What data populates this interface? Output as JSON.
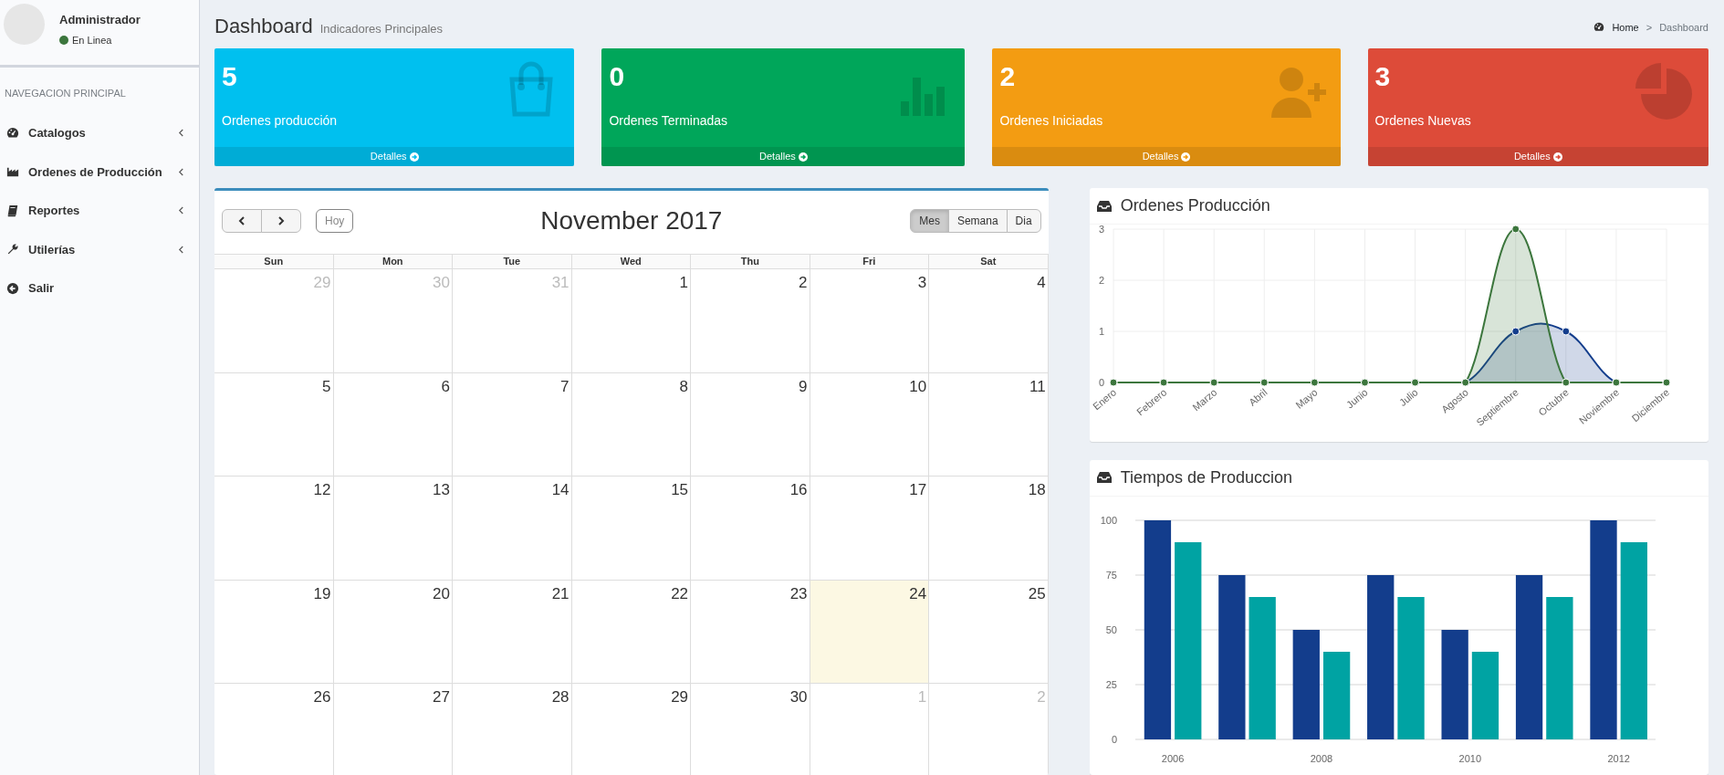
{
  "sidebar": {
    "user": {
      "name": "Administrador",
      "status": "En Linea"
    },
    "header": "NAVEGACION PRINCIPAL",
    "items": [
      {
        "label": "Catalogos",
        "expandable": true
      },
      {
        "label": "Ordenes de Producción",
        "expandable": true
      },
      {
        "label": "Reportes",
        "expandable": true
      },
      {
        "label": "Utilerías",
        "expandable": true
      },
      {
        "label": "Salir",
        "expandable": false
      }
    ]
  },
  "page_header": {
    "title": "Dashboard",
    "subtitle": "Indicadores Principales",
    "breadcrumb": {
      "items": [
        "Home",
        "Dashboard"
      ],
      "separator": ">"
    }
  },
  "info_boxes": [
    {
      "number": "5",
      "label": "Ordenes producción",
      "footer": "Detalles",
      "color": "#00c0ef"
    },
    {
      "number": "0",
      "label": "Ordenes Terminadas",
      "footer": "Detalles",
      "color": "#00a65a"
    },
    {
      "number": "2",
      "label": "Ordenes Iniciadas",
      "footer": "Detalles",
      "color": "#f39c12"
    },
    {
      "number": "3",
      "label": "Ordenes Nuevas",
      "footer": "Detalles",
      "color": "#dd4b39"
    }
  ],
  "calendar": {
    "title": "November 2017",
    "today_button": {
      "label": "Hoy",
      "disabled": true
    },
    "views": [
      {
        "label": "Mes",
        "selected": true
      },
      {
        "label": "Semana",
        "selected": false
      },
      {
        "label": "Dia",
        "selected": false
      }
    ],
    "weekdays": [
      "Sun",
      "Mon",
      "Tue",
      "Wed",
      "Thu",
      "Fri",
      "Sat"
    ],
    "weeks": [
      [
        {
          "day": "29",
          "other_month": true,
          "today": false
        },
        {
          "day": "30",
          "other_month": true,
          "today": false
        },
        {
          "day": "31",
          "other_month": true,
          "today": false
        },
        {
          "day": "1",
          "other_month": false,
          "today": false
        },
        {
          "day": "2",
          "other_month": false,
          "today": false
        },
        {
          "day": "3",
          "other_month": false,
          "today": false
        },
        {
          "day": "4",
          "other_month": false,
          "today": false
        }
      ],
      [
        {
          "day": "5",
          "other_month": false,
          "today": false
        },
        {
          "day": "6",
          "other_month": false,
          "today": false
        },
        {
          "day": "7",
          "other_month": false,
          "today": false
        },
        {
          "day": "8",
          "other_month": false,
          "today": false
        },
        {
          "day": "9",
          "other_month": false,
          "today": false
        },
        {
          "day": "10",
          "other_month": false,
          "today": false
        },
        {
          "day": "11",
          "other_month": false,
          "today": false
        }
      ],
      [
        {
          "day": "12",
          "other_month": false,
          "today": false
        },
        {
          "day": "13",
          "other_month": false,
          "today": false
        },
        {
          "day": "14",
          "other_month": false,
          "today": false
        },
        {
          "day": "15",
          "other_month": false,
          "today": false
        },
        {
          "day": "16",
          "other_month": false,
          "today": false
        },
        {
          "day": "17",
          "other_month": false,
          "today": false
        },
        {
          "day": "18",
          "other_month": false,
          "today": false
        }
      ],
      [
        {
          "day": "19",
          "other_month": false,
          "today": false
        },
        {
          "day": "20",
          "other_month": false,
          "today": false
        },
        {
          "day": "21",
          "other_month": false,
          "today": false
        },
        {
          "day": "22",
          "other_month": false,
          "today": false
        },
        {
          "day": "23",
          "other_month": false,
          "today": false
        },
        {
          "day": "24",
          "other_month": false,
          "today": true
        },
        {
          "day": "25",
          "other_month": false,
          "today": false
        }
      ],
      [
        {
          "day": "26",
          "other_month": false,
          "today": false
        },
        {
          "day": "27",
          "other_month": false,
          "today": false
        },
        {
          "day": "28",
          "other_month": false,
          "today": false
        },
        {
          "day": "29",
          "other_month": false,
          "today": false
        },
        {
          "day": "30",
          "other_month": false,
          "today": false
        },
        {
          "day": "1",
          "other_month": true,
          "today": false
        },
        {
          "day": "2",
          "other_month": true,
          "today": false
        }
      ]
    ]
  },
  "charts": [
    {
      "title": "Ordenes Producción",
      "chart_data": {
        "type": "area",
        "categories": [
          "Enero",
          "Febrero",
          "Marzo",
          "Abril",
          "Mayo",
          "Junio",
          "Julio",
          "Agosto",
          "Septiembre",
          "Octubre",
          "Noviembre",
          "Diciembre"
        ],
        "series": [
          {
            "color": "#133d8c",
            "values": [
              0,
              0,
              0,
              0,
              0,
              0,
              0,
              0,
              1,
              1,
              0,
              0
            ]
          },
          {
            "color": "#3c763d",
            "values": [
              0,
              0,
              0,
              0,
              0,
              0,
              0,
              0,
              3,
              0,
              0,
              0
            ]
          }
        ],
        "ylim": [
          0,
          3
        ],
        "yticks": [
          0,
          1,
          2,
          3
        ],
        "grid": true
      }
    },
    {
      "title": "Tiempos de Produccion",
      "chart_data": {
        "type": "bar",
        "series": [
          {
            "color": "#133d8c",
            "values": [
              100,
              75,
              50,
              75,
              50,
              75,
              100
            ]
          },
          {
            "color": "#00a3a3",
            "values": [
              90,
              65,
              40,
              65,
              40,
              65,
              90
            ]
          }
        ],
        "categories": [
          "2006",
          null,
          "2008",
          null,
          "2010",
          null,
          "2012"
        ],
        "ylim": [
          0,
          100
        ],
        "yticks": [
          0,
          25,
          50,
          75,
          100
        ],
        "grid": true
      }
    }
  ]
}
